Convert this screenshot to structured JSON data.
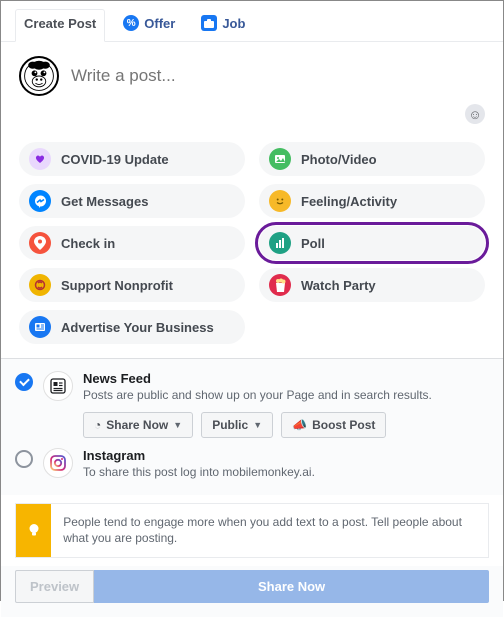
{
  "tabs": {
    "create": "Create Post",
    "offer": "Offer",
    "job": "Job"
  },
  "composer": {
    "placeholder": "Write a post..."
  },
  "options": [
    {
      "id": "covid",
      "label": "COVID-19 Update",
      "icon": "heart",
      "bg": "#e9d8fd",
      "fg": "#8a2be2"
    },
    {
      "id": "photo",
      "label": "Photo/Video",
      "icon": "image",
      "bg": "#45bd62",
      "fg": "#fff"
    },
    {
      "id": "messages",
      "label": "Get Messages",
      "icon": "chat",
      "bg": "#0084ff",
      "fg": "#fff"
    },
    {
      "id": "feeling",
      "label": "Feeling/Activity",
      "icon": "smiley",
      "bg": "#f7b928",
      "fg": "#7a5c00"
    },
    {
      "id": "checkin",
      "label": "Check in",
      "icon": "pin",
      "bg": "#f5533d",
      "fg": "#fff"
    },
    {
      "id": "poll",
      "label": "Poll",
      "icon": "bars",
      "bg": "#1fa184",
      "fg": "#fff",
      "highlight": true
    },
    {
      "id": "nonprofit",
      "label": "Support Nonprofit",
      "icon": "coin",
      "bg": "#f0b400",
      "fg": "#b53131"
    },
    {
      "id": "watch",
      "label": "Watch Party",
      "icon": "popcorn",
      "bg": "#e02c4d",
      "fg": "#fff"
    },
    {
      "id": "advertise",
      "label": "Advertise Your Business",
      "icon": "ad",
      "bg": "#1877f2",
      "fg": "#fff"
    }
  ],
  "share": {
    "newsfeed": {
      "title": "News Feed",
      "desc": "Posts are public and show up on your Page and in search results.",
      "btn_sharenow": "Share Now",
      "btn_public": "Public",
      "btn_boost": "Boost Post"
    },
    "instagram": {
      "title": "Instagram",
      "desc": "To share this post log into mobilemonkey.ai."
    }
  },
  "tip": "People tend to engage more when you add text to a post. Tell people about what you are posting.",
  "footer": {
    "preview": "Preview",
    "share": "Share Now"
  }
}
